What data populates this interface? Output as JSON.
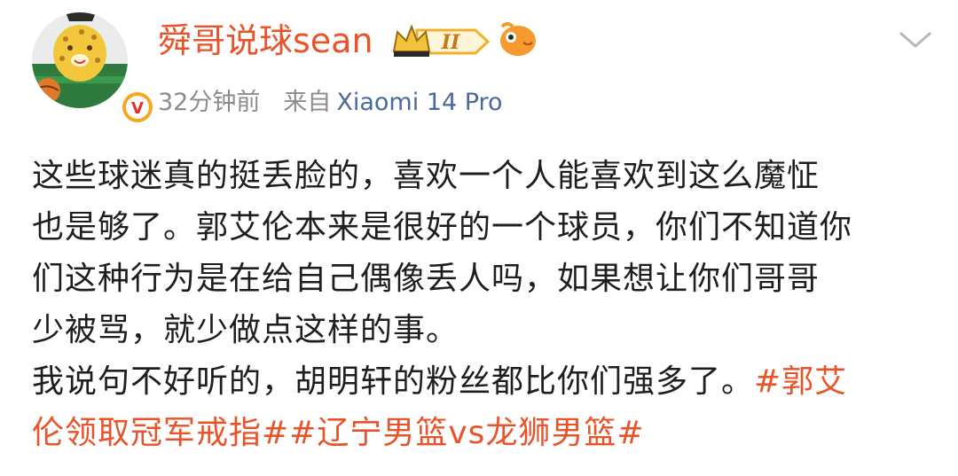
{
  "post": {
    "author": {
      "name": "舜哥说球sean",
      "vip_level": "II",
      "verified_mark": "V"
    },
    "meta": {
      "time": "32分钟前",
      "from_label": "来自",
      "device": "Xiaomi 14 Pro"
    },
    "body": {
      "lines": [
        "这些球迷真的挺丢脸的，喜欢一个人能喜欢到这么魔怔",
        "也是够了。郭艾伦本来是很好的一个球员，你们不知道你",
        "们这种行为是在给自己偶像丢人吗，如果想让你们哥哥",
        "少被骂，就少做点这样的事。"
      ],
      "last_line_text": "我说句不好听的，胡明轩的粉丝都比你们强多了。",
      "last_line_tag": "#郭艾",
      "tag_line": "伦领取冠军戒指##辽宁男篮vs龙狮男篮#"
    },
    "icons": {
      "avatar": "cartoon-leopard-avatar",
      "verified": "verified-badge-icon",
      "vip": "crown-vip-icon",
      "fish": "fish-emoji-icon",
      "menu": "chevron-down-icon"
    },
    "colors": {
      "username": "#e8532a",
      "tag": "#e8532a",
      "meta": "#8c8c8c",
      "device": "#4a6a9a"
    }
  }
}
